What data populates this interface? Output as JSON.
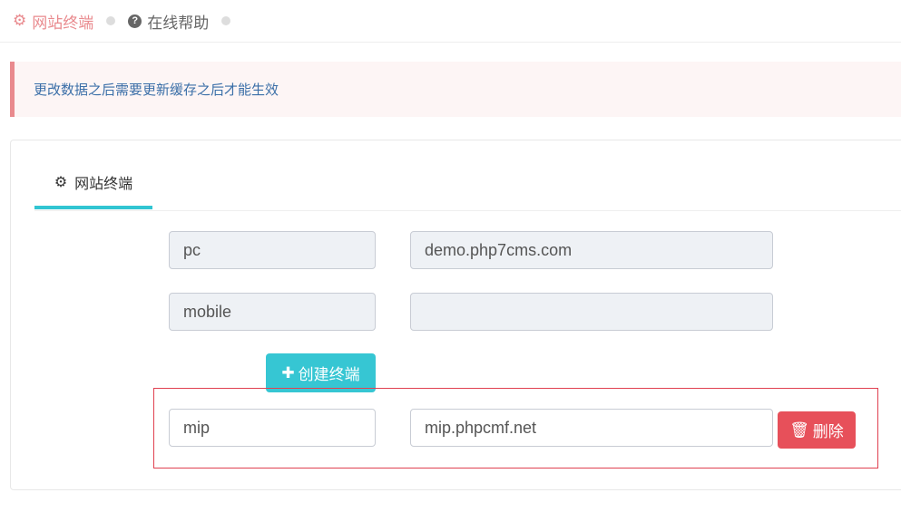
{
  "topbar": {
    "items": [
      {
        "label": "网站终端",
        "icon": "gear-icon",
        "color": "#e98a8e"
      },
      {
        "label": "在线帮助",
        "icon": "question-circle-icon",
        "color": "#666"
      }
    ]
  },
  "notice": "更改数据之后需要更新缓存之后才能生效",
  "tab": {
    "label": "网站终端",
    "icon": "gear-icon"
  },
  "rows": [
    {
      "name": "pc",
      "domain": "demo.php7cms.com"
    },
    {
      "name": "mobile",
      "domain": ""
    }
  ],
  "create_label": "创建终端",
  "new_row": {
    "name": "mip",
    "domain": "mip.phpcmf.net",
    "delete_label": "删除"
  }
}
